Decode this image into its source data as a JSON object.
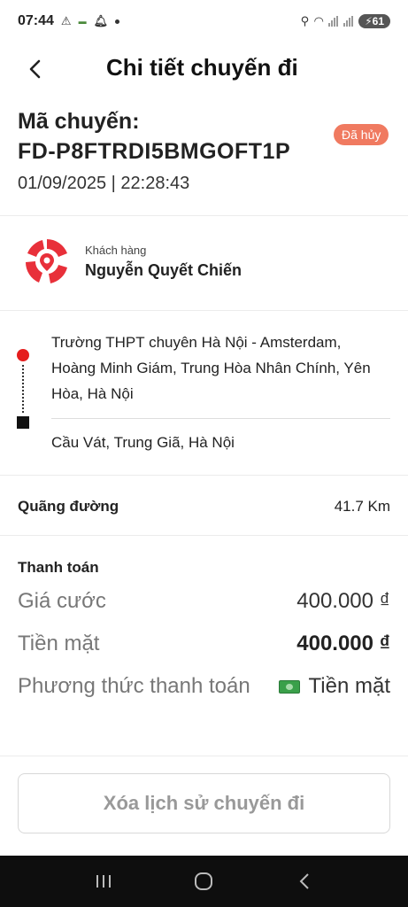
{
  "status_bar": {
    "time": "07:44",
    "battery": "61"
  },
  "header": {
    "title": "Chi tiết chuyến đi"
  },
  "trip": {
    "code_label": "Mã chuyến:",
    "code": "FD-P8FTRDI5BMGOFT1P",
    "datetime": "01/09/2025 | 22:28:43",
    "status": "Đã hủy"
  },
  "customer": {
    "label": "Khách hàng",
    "name": "Nguyễn Quyết Chiến"
  },
  "route": {
    "pickup": "Trường THPT chuyên Hà Nội - Amsterdam, Hoàng Minh Giám, Trung Hòa Nhân Chính, Yên Hòa, Hà Nội",
    "dropoff": "Cầu Vát, Trung Giã, Hà Nội"
  },
  "distance": {
    "label": "Quãng đường",
    "value": "41.7 Km"
  },
  "payment": {
    "title": "Thanh toán",
    "fare_label": "Giá cước",
    "fare_value": "400.000 ₫",
    "cash_label": "Tiền mặt",
    "cash_value": "400.000 ₫",
    "method_label": "Phương thức thanh toán",
    "method_value": "Tiền mặt",
    "method_icon": "cash-icon"
  },
  "actions": {
    "delete_label": "Xóa lịch sử chuyến đi"
  },
  "colors": {
    "badge": "#f07a60",
    "pickup": "#e51d1d",
    "brand": "#e8303a"
  }
}
